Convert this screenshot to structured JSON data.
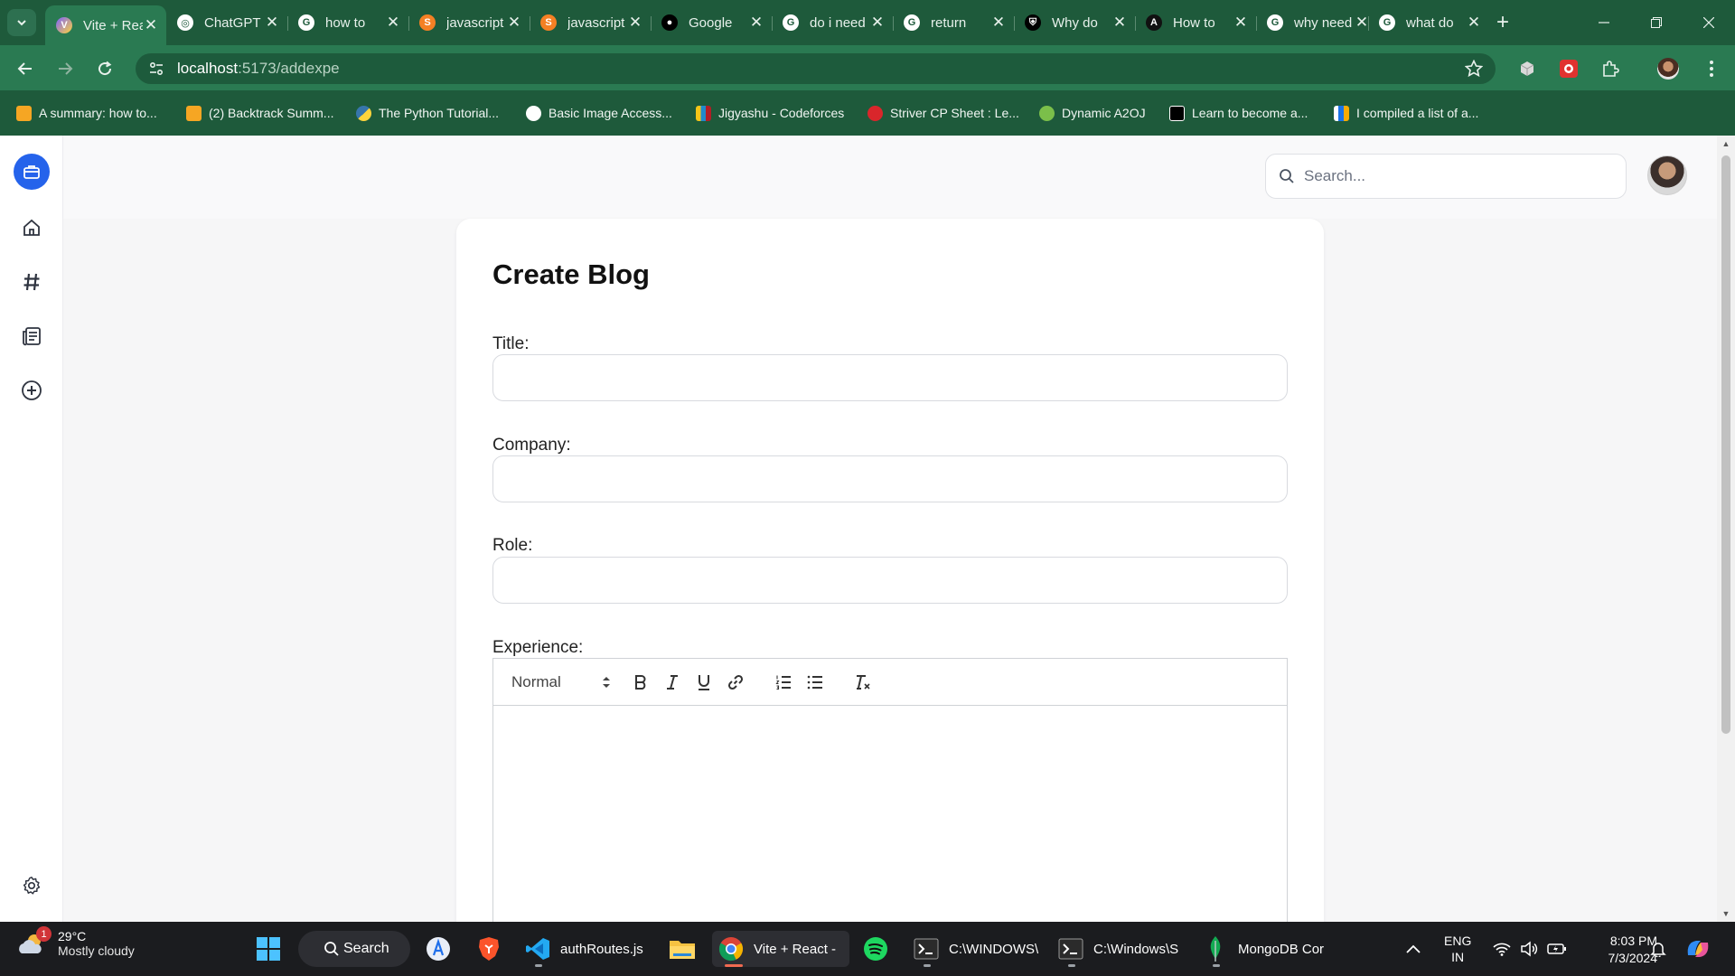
{
  "browser": {
    "tabs": [
      {
        "title": "Vite + React",
        "icon": "vite-icon",
        "active": true
      },
      {
        "title": "ChatGPT",
        "icon": "chatgpt-icon"
      },
      {
        "title": "how to",
        "icon": "google-icon"
      },
      {
        "title": "javascript",
        "icon": "stackoverflow-icon"
      },
      {
        "title": "javascript",
        "icon": "stackoverflow-icon"
      },
      {
        "title": "Google",
        "icon": "medium-icon"
      },
      {
        "title": "do i need",
        "icon": "google-icon"
      },
      {
        "title": "return",
        "icon": "google-icon"
      },
      {
        "title": "Why do",
        "icon": "shield-icon"
      },
      {
        "title": "How to",
        "icon": "angular-icon"
      },
      {
        "title": "why need",
        "icon": "google-icon"
      },
      {
        "title": "what do",
        "icon": "google-icon"
      }
    ],
    "url_host": "localhost",
    "url_path": ":5173/addexpe",
    "bookmarks": [
      "A summary: how to...",
      "(2) Backtrack Summ...",
      "The Python Tutorial...",
      "Basic Image Access...",
      "Jigyashu - Codeforces",
      "Striver CP Sheet : Le...",
      "Dynamic A2OJ",
      "Learn to become a...",
      "I compiled a list of a..."
    ]
  },
  "app": {
    "search_placeholder": "Search...",
    "form": {
      "heading": "Create Blog",
      "title_label": "Title:",
      "company_label": "Company:",
      "role_label": "Role:",
      "experience_label": "Experience:",
      "title_value": "",
      "company_value": "",
      "role_value": ""
    },
    "editor": {
      "format_selected": "Normal",
      "content": ""
    }
  },
  "taskbar": {
    "weather_temp": "29°C",
    "weather_cond": "Mostly cloudy",
    "weather_badge": "1",
    "search_label": "Search",
    "apps": [
      {
        "label": "authRoutes.js",
        "icon": "vscode-icon"
      },
      {
        "label": "Vite + React -",
        "icon": "chrome-icon"
      },
      {
        "label": "C:\\WINDOWS\\",
        "icon": "terminal-icon"
      },
      {
        "label": "C:\\Windows\\S",
        "icon": "terminal-icon"
      },
      {
        "label": "MongoDB Cor",
        "icon": "mongodb-icon"
      }
    ],
    "lang": "ENG",
    "region": "IN",
    "time": "8:03 PM",
    "date": "7/3/2024"
  },
  "colors": {
    "chrome_dark": "#1e5a3b",
    "chrome_light": "#2a7a52",
    "accent": "#2563eb"
  }
}
